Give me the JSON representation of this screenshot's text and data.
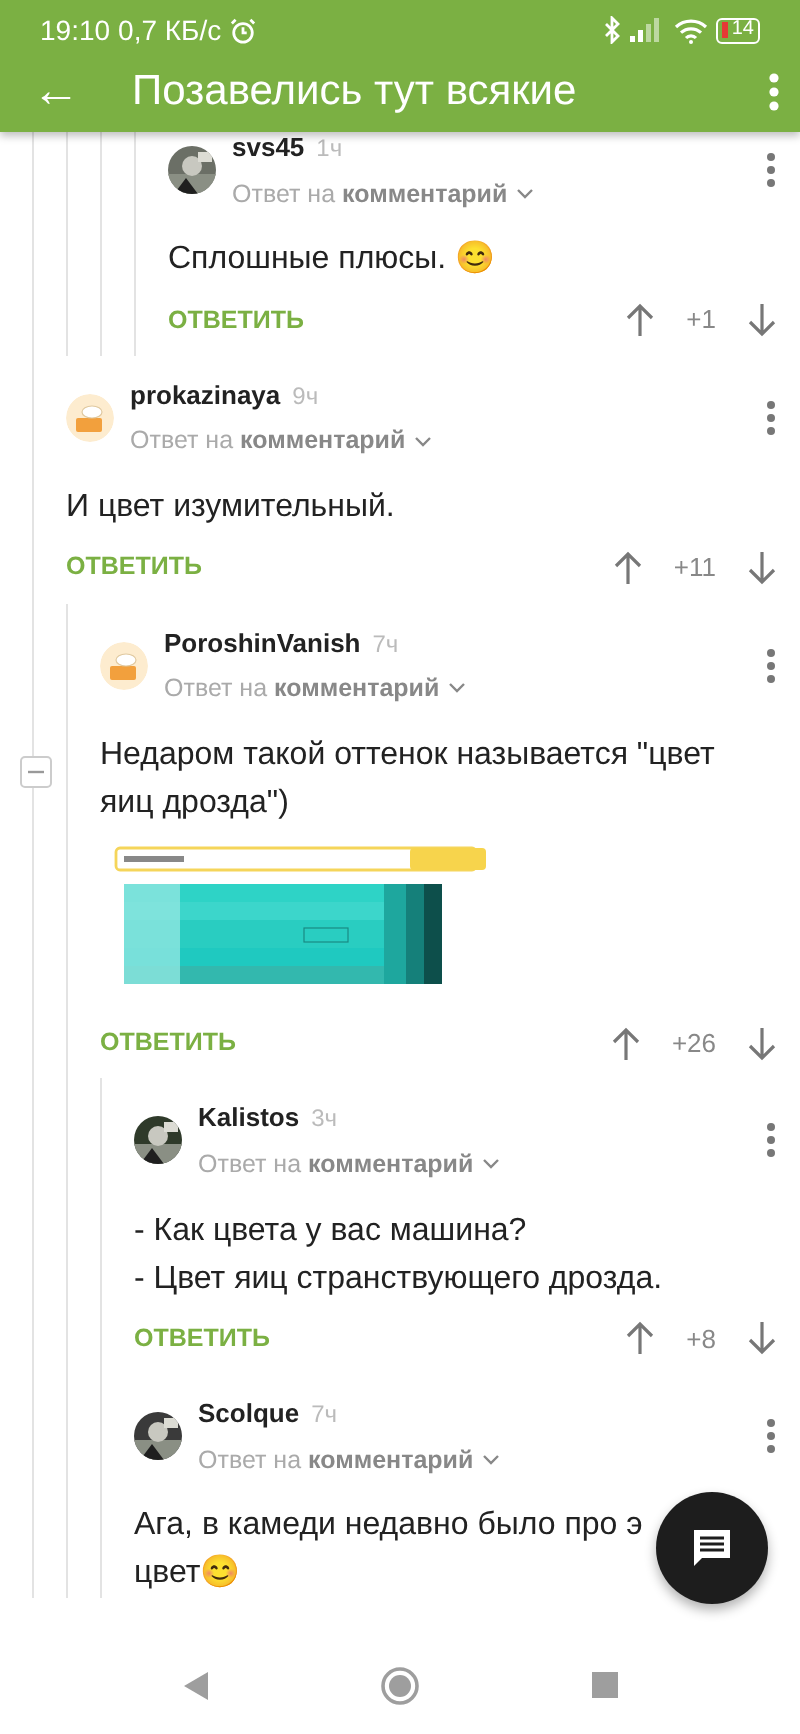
{
  "status_bar": {
    "time": "19:10",
    "speed": "0,7 КБ/с",
    "battery": "14"
  },
  "app_bar": {
    "back": "←",
    "title": "Позавелись тут всякие"
  },
  "comments": [
    {
      "children": [
        {
          "children": [
            {
              "children": [
                {
                  "children": [
                    {
                      "author": "svs45",
                      "time": "1ч",
                      "avatar": {
                        "kind": "picture"
                      },
                      "reply_info": "Ответ на **комментарий**",
                      "lines": [
                        "Сплошные плюсы. 😊"
                      ],
                      "reply_label": "ОТВЕТИТЬ",
                      "score": "+1"
                    }
                  ]
                }
              ]
            }
          ]
        },
        {
          "author": "prokazinaya",
          "time": "9ч",
          "avatar": {
            "kind": "icon"
          },
          "reply_info": "Ответ на **комментарий**",
          "lines": [
            "И цвет изумительный."
          ],
          "reply_label": "ОТВЕТИТЬ",
          "score": "+11",
          "children": [
            {
              "author": "PoroshinVanish",
              "time": "7ч",
              "avatar": {
                "kind": "icon"
              },
              "collapse": true,
              "reply_info": "Ответ на **комментарий**",
              "lines": [
                "Недаром такой оттенок называется \"цвет яиц дрозда\")"
              ],
              "image": {
                "kind": "picture"
              },
              "reply_label": "ОТВЕТИТЬ",
              "score": "+26",
              "children": [
                {
                  "author": "Kalistos",
                  "time": "3ч",
                  "avatar": {
                    "kind": "picture"
                  },
                  "reply_info": "Ответ на **комментарий**",
                  "lines": [
                    "- Как цвета у вас машина?",
                    "- Цвет яиц странствующего дрозда."
                  ],
                  "reply_label": "ОТВЕТИТЬ",
                  "score": "+8"
                },
                {
                  "author": "Scolque",
                  "time": "7ч",
                  "avatar": {
                    "kind": "picture"
                  },
                  "reply_info": "Ответ на **комментарий**",
                  "lines": [
                    "Ага, в камеди недавно было про э",
                    "цвет😊"
                  ]
                }
              ]
            }
          ]
        }
      ]
    }
  ]
}
